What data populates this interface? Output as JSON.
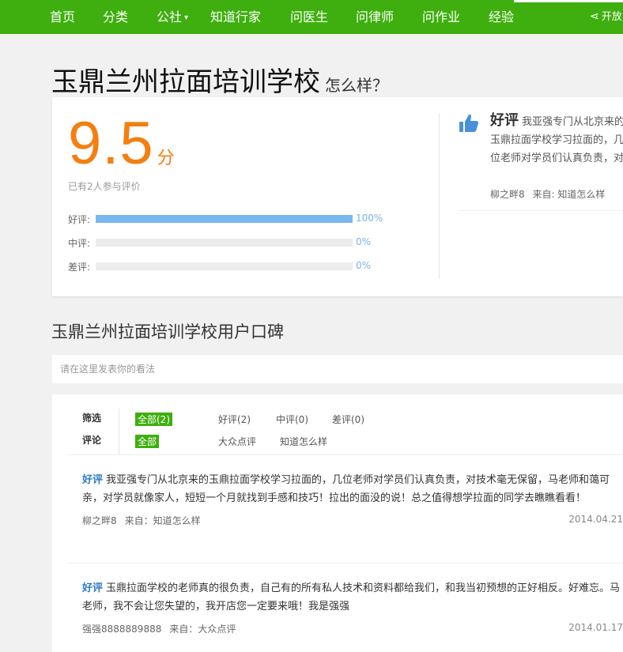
{
  "nav": {
    "items": [
      "首页",
      "分类",
      "公社",
      "知道行家",
      "问医生",
      "问律师",
      "问作业",
      "经验"
    ],
    "share_label": "开放"
  },
  "title": {
    "main": "玉鼎兰州拉面培训学校",
    "sub": "怎么样？"
  },
  "score": {
    "value": "9.5",
    "unit": "分",
    "participants": "已有2人参与评价",
    "ratings": [
      {
        "label": "好评:",
        "percent": "100%",
        "fill": 1.0
      },
      {
        "label": "中评:",
        "percent": "0%",
        "fill": 0
      },
      {
        "label": "差评:",
        "percent": "0%",
        "fill": 0
      }
    ]
  },
  "top_review": {
    "tag": "好评",
    "text": "我亚强专门从北京来的玉鼎拉面学校学习拉面的，几位老师对学员们认真负责，对技术毫无保留，马老师和蔼可亲，对学员就像家人，短短一个月就找到手感和技巧！",
    "author": "柳之畔8",
    "source_prefix": "来自:",
    "source": "知道怎么样"
  },
  "section": {
    "title": "玉鼎兰州拉面培训学校用户口碑",
    "comment_placeholder": "请在这里发表你的看法"
  },
  "filters": {
    "filter_label": "筛选",
    "filter_options": [
      "全部(2)",
      "好评(2)",
      "中评(0)",
      "差评(0)"
    ],
    "comment_label": "评论",
    "comment_options": [
      "全部",
      "大众点评",
      "知道怎么样"
    ]
  },
  "reviews": [
    {
      "tag": "好评",
      "text": "我亚强专门从北京来的玉鼎拉面学校学习拉面的，几位老师对学员们认真负责，对技术毫无保留，马老师和蔼可亲，对学员就像家人，短短一个月就找到手感和技巧！拉出的面没的说！总之值得想学拉面的同学去瞧瞧看看！",
      "author": "柳之畔8",
      "source": "来自：知道怎么样",
      "date": "2014.04.21"
    },
    {
      "tag": "好评",
      "text": "玉鼎拉面学校的老师真的很负责，自己有的所有私人技术和资料都给我们，和我当初预想的正好相反。好难忘。马老师，我不会让您失望的，我开店您一定要来哦！我是强强",
      "author": "强强8888889888",
      "source": "来自：大众点评",
      "date": "2014.01.17"
    }
  ],
  "colors": {
    "nav_green": "#3eaf0e",
    "score_orange": "#f47f11",
    "bar_blue": "#78b7f0",
    "tag_blue": "#2d7ac6"
  },
  "icons": [
    "share-icon",
    "thumbs-up-icon",
    "chevron-down-icon"
  ]
}
